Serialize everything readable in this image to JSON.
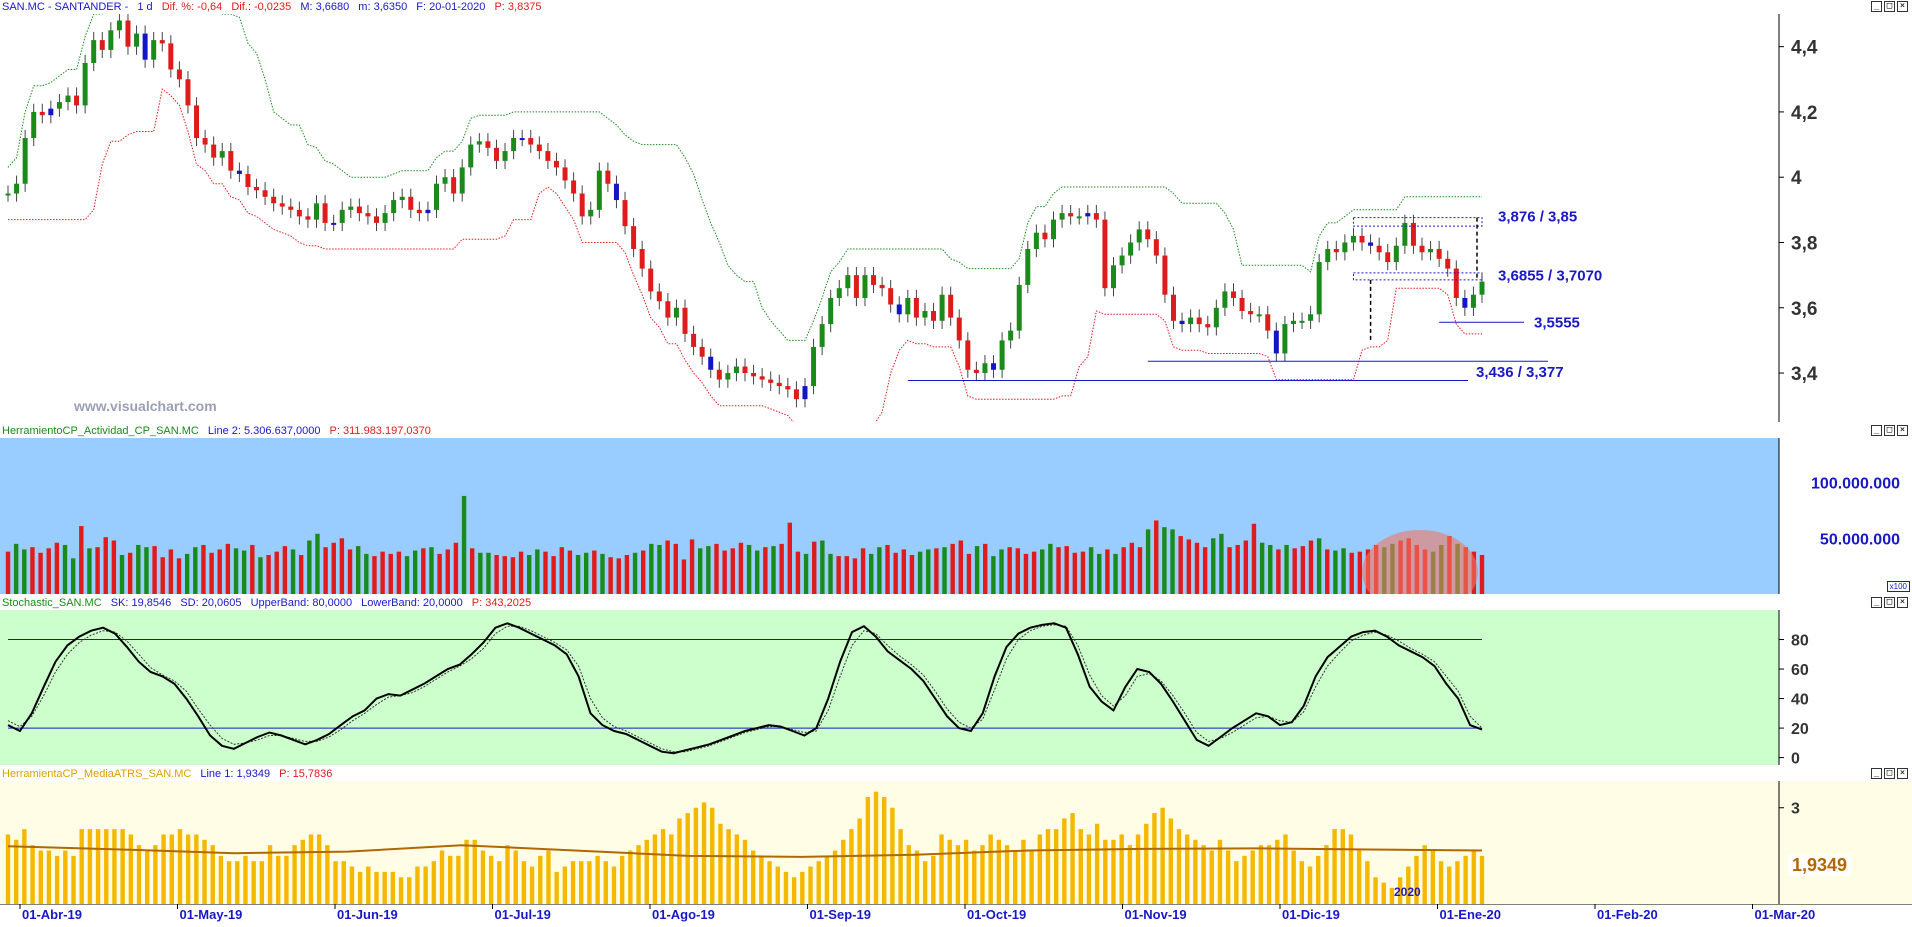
{
  "price_panel": {
    "header": {
      "symbol": "SAN.MC - SANTANDER -",
      "period": "1 d",
      "dif_pct": "Dif. %: -0,64",
      "dif": "Dif.: -0,0235",
      "max": "M: 3,6680",
      "min": "m: 3,6350",
      "date": "F: 20-01-2020",
      "price": "P: 3,8375"
    },
    "watermark": "www.visualchart.com",
    "annotations": [
      "3,876 / 3,85",
      "3,6855 / 3,7070",
      "3,5555",
      "3,436 / 3,377"
    ]
  },
  "volume_panel": {
    "header": {
      "name": "HerramientoCP_Actividad_CP_SAN.MC",
      "line": "Line 2: 5.306.637,0000",
      "price": "P: 311.983.197,0370"
    },
    "badge": "x100"
  },
  "stoch_panel": {
    "header": {
      "name": "Stochastic_SAN.MC",
      "sk": "SK: 19,8546",
      "sd": "SD: 20,0605",
      "upper": "UpperBand: 80,0000",
      "lower": "LowerBand: 20,0000",
      "price": "P: 343,2025"
    }
  },
  "atr_panel": {
    "header": {
      "name": "HerramientaCP_MediaATRS_SAN.MC",
      "line": "Line 1: 1,9349",
      "price": "P: 15,7836"
    },
    "value_label": "1,9349",
    "year_label": "2020"
  },
  "x_axis_labels": [
    "01-Abr-19",
    "01-May-19",
    "01-Jun-19",
    "01-Jul-19",
    "01-Ago-19",
    "01-Sep-19",
    "01-Oct-19",
    "01-Nov-19",
    "01-Dic-19",
    "01-Ene-20",
    "01-Feb-20",
    "01-Mar-20"
  ],
  "colors": {
    "up": "#1a8a1a",
    "down": "#e01b1b",
    "blue_candle": "#1515c8",
    "annotation": "#1818c8",
    "volume_bg": "#99ccff",
    "stoch_bg": "#ccffcc",
    "atr_bg": "#fffde6",
    "atr_bar": "#f5b800",
    "atr_line": "#b06800"
  },
  "chart_data": [
    {
      "type": "candlestick",
      "title": "SAN.MC - SANTANDER",
      "ylim": [
        3.25,
        4.5
      ],
      "yticks": [
        "4,4",
        "4,2",
        "4",
        "3,8",
        "3,6",
        "3,4"
      ],
      "ytick_values": [
        4.4,
        4.2,
        4.0,
        3.8,
        3.6,
        3.4
      ],
      "series": [
        {
          "name": "SANTANDER",
          "values": [
            3.95,
            3.98,
            4.12,
            4.2,
            4.19,
            4.21,
            4.23,
            4.25,
            4.22,
            4.35,
            4.42,
            4.39,
            4.45,
            4.48,
            4.4,
            4.44,
            4.36,
            4.42,
            4.41,
            4.33,
            4.3,
            4.22,
            4.12,
            4.1,
            4.06,
            4.08,
            4.02,
            4.01,
            3.97,
            3.96,
            3.94,
            3.92,
            3.91,
            3.9,
            3.88,
            3.87,
            3.92,
            3.86,
            3.86,
            3.9,
            3.91,
            3.89,
            3.88,
            3.86,
            3.89,
            3.93,
            3.94,
            3.9,
            3.89,
            3.9,
            3.98,
            4.0,
            3.95,
            4.03,
            4.1,
            4.11,
            4.09,
            4.05,
            4.08,
            4.12,
            4.12,
            4.1,
            4.08,
            4.05,
            4.03,
            3.99,
            3.95,
            3.88,
            3.9,
            4.02,
            3.98,
            3.93,
            3.85,
            3.78,
            3.72,
            3.65,
            3.62,
            3.57,
            3.6,
            3.52,
            3.48,
            3.45,
            3.41,
            3.38,
            3.4,
            3.42,
            3.4,
            3.39,
            3.38,
            3.37,
            3.36,
            3.35,
            3.32,
            3.36,
            3.48,
            3.55,
            3.63,
            3.66,
            3.7,
            3.63,
            3.7,
            3.67,
            3.66,
            3.61,
            3.58,
            3.63,
            3.57,
            3.59,
            3.56,
            3.64,
            3.57,
            3.5,
            3.41,
            3.4,
            3.43,
            3.41,
            3.5,
            3.53,
            3.67,
            3.78,
            3.83,
            3.81,
            3.87,
            3.89,
            3.88,
            3.88,
            3.89,
            3.87,
            3.66,
            3.73,
            3.76,
            3.8,
            3.84,
            3.81,
            3.76,
            3.64,
            3.56,
            3.55,
            3.57,
            3.55,
            3.54,
            3.6,
            3.65,
            3.63,
            3.59,
            3.58,
            3.58,
            3.53,
            3.46,
            3.55,
            3.56,
            3.56,
            3.58,
            3.74,
            3.78,
            3.77,
            3.8,
            3.82,
            3.8,
            3.79,
            3.77,
            3.74,
            3.79,
            3.86,
            3.79,
            3.77,
            3.78,
            3.75,
            3.72,
            3.63,
            3.6,
            3.64,
            3.68
          ]
        }
      ]
    },
    {
      "type": "bar",
      "title": "HerramientoCP_Actividad_CP_SAN.MC",
      "ylim": [
        0,
        140000000
      ],
      "yticks": [
        "100.000.000",
        "50.000.000"
      ],
      "ytick_values": [
        100000000,
        50000000
      ],
      "series": [
        {
          "name": "Actividad",
          "values": [
            38,
            45,
            40,
            42,
            37,
            41,
            46,
            44,
            32,
            61,
            41,
            42,
            51,
            48,
            35,
            37,
            44,
            42,
            43,
            33,
            40,
            32,
            36,
            42,
            44,
            37,
            40,
            45,
            41,
            39,
            44,
            33,
            35,
            38,
            43,
            40,
            35,
            48,
            54,
            42,
            46,
            50,
            40,
            43,
            36,
            34,
            38,
            36,
            38,
            34,
            39,
            41,
            42,
            36,
            40,
            46,
            88,
            41,
            37,
            37,
            35,
            34,
            33,
            38,
            35,
            40,
            38,
            34,
            42,
            39,
            35,
            37,
            39,
            36,
            33,
            32,
            35,
            37,
            39,
            45,
            44,
            48,
            45,
            31,
            49,
            41,
            43,
            45,
            39,
            41,
            46,
            44,
            39,
            42,
            43,
            45,
            64,
            38,
            36,
            47,
            48,
            36,
            34,
            34,
            32,
            41,
            36,
            42,
            44,
            37,
            40,
            35,
            38,
            40,
            41,
            42,
            45,
            48,
            36,
            43,
            45,
            34,
            40,
            42,
            41,
            36,
            38,
            40,
            45,
            42,
            43,
            37,
            38,
            42,
            36,
            40,
            36,
            42,
            46,
            42,
            58,
            66,
            60,
            58,
            52,
            49,
            46,
            42,
            50,
            54,
            42,
            44,
            48,
            63,
            46,
            44,
            40,
            44,
            41,
            43,
            48,
            50,
            40,
            39,
            41,
            37,
            38,
            40,
            44,
            42,
            45,
            48,
            50,
            44,
            40,
            38,
            44,
            52,
            45,
            42,
            38,
            35
          ]
        }
      ]
    },
    {
      "type": "line",
      "title": "Stochastic_SAN.MC",
      "ylim": [
        -5,
        100
      ],
      "yticks": [
        "80",
        "60",
        "40",
        "20",
        "0"
      ],
      "ytick_values": [
        80,
        60,
        40,
        20,
        0
      ],
      "upper_band": 80,
      "lower_band": 20,
      "series": [
        {
          "name": "SK",
          "values": [
            22,
            18,
            30,
            48,
            65,
            76,
            82,
            86,
            88,
            84,
            75,
            65,
            58,
            55,
            50,
            40,
            28,
            15,
            8,
            6,
            10,
            14,
            17,
            15,
            12,
            9,
            12,
            16,
            22,
            28,
            32,
            40,
            43,
            42,
            46,
            50,
            55,
            60,
            63,
            70,
            78,
            88,
            91,
            88,
            84,
            80,
            76,
            70,
            55,
            30,
            22,
            18,
            16,
            12,
            8,
            4,
            3,
            5,
            7,
            9,
            12,
            15,
            18,
            20,
            22,
            21,
            18,
            15,
            20,
            40,
            65,
            85,
            89,
            82,
            72,
            66,
            60,
            52,
            40,
            28,
            20,
            18,
            30,
            55,
            75,
            84,
            88,
            90,
            91,
            88,
            70,
            48,
            38,
            32,
            48,
            60,
            58,
            50,
            38,
            25,
            12,
            8,
            14,
            20,
            25,
            30,
            28,
            22,
            24,
            35,
            55,
            68,
            75,
            82,
            85,
            86,
            82,
            76,
            72,
            68,
            62,
            50,
            40,
            22,
            19
          ]
        },
        {
          "name": "SD",
          "values": [
            25,
            21,
            28,
            42,
            58,
            70,
            78,
            83,
            86,
            85,
            79,
            70,
            61,
            56,
            52,
            45,
            33,
            22,
            13,
            9,
            10,
            12,
            15,
            15,
            13,
            11,
            11,
            14,
            19,
            25,
            30,
            36,
            41,
            42,
            44,
            48,
            53,
            58,
            62,
            67,
            74,
            84,
            89,
            89,
            86,
            82,
            78,
            73,
            62,
            40,
            27,
            21,
            18,
            14,
            10,
            6,
            4,
            4,
            6,
            8,
            11,
            14,
            17,
            19,
            21,
            21,
            19,
            17,
            18,
            32,
            55,
            76,
            86,
            84,
            76,
            69,
            63,
            56,
            45,
            33,
            24,
            20,
            26,
            46,
            67,
            80,
            86,
            89,
            90,
            89,
            76,
            56,
            42,
            35,
            42,
            55,
            57,
            52,
            42,
            30,
            17,
            11,
            13,
            17,
            22,
            27,
            28,
            25,
            24,
            31,
            48,
            62,
            71,
            79,
            83,
            85,
            83,
            79,
            74,
            70,
            65,
            55,
            45,
            28,
            20
          ]
        }
      ]
    },
    {
      "type": "bar",
      "title": "HerramientaCP_MediaATRS_SAN.MC",
      "ylim": [
        1.2,
        3.5
      ],
      "yticks": [
        "3"
      ],
      "ytick_values": [
        3
      ],
      "series": [
        {
          "name": "ATR",
          "values": [
            2.5,
            2.4,
            2.6,
            2.3,
            2.2,
            2.2,
            2.1,
            2.2,
            2.1,
            2.6,
            2.6,
            2.6,
            2.6,
            2.6,
            2.6,
            2.5,
            2.3,
            2.2,
            2.3,
            2.5,
            2.5,
            2.6,
            2.5,
            2.5,
            2.4,
            2.3,
            2.1,
            2.0,
            2.0,
            2.1,
            2.0,
            2.0,
            2.3,
            2.1,
            2.1,
            2.3,
            2.4,
            2.5,
            2.5,
            2.3,
            2.0,
            2.0,
            1.9,
            1.8,
            1.9,
            1.8,
            1.8,
            1.8,
            1.7,
            1.7,
            1.9,
            1.9,
            2.0,
            2.2,
            2.1,
            2.1,
            2.4,
            2.4,
            2.2,
            2.1,
            2.0,
            2.3,
            2.2,
            2.0,
            1.9,
            2.1,
            2.2,
            1.8,
            1.9,
            2.0,
            2.0,
            2.0,
            2.1,
            2.0,
            1.9,
            2.1,
            2.2,
            2.3,
            2.4,
            2.5,
            2.6,
            2.5,
            2.8,
            2.9,
            3.0,
            3.1,
            3.0,
            2.7,
            2.6,
            2.5,
            2.4,
            2.2,
            2.1,
            2.0,
            1.9,
            1.8,
            1.7,
            1.8,
            1.9,
            2.0,
            2.1,
            2.2,
            2.4,
            2.6,
            2.8,
            3.2,
            3.3,
            3.2,
            3.0,
            2.6,
            2.3,
            2.2,
            2.0,
            2.1,
            2.5,
            2.4,
            2.3,
            2.4,
            2.2,
            2.3,
            2.5,
            2.4,
            2.3,
            2.2,
            2.4,
            2.2,
            2.5,
            2.6,
            2.6,
            2.8,
            2.9,
            2.6,
            2.5,
            2.7,
            2.4,
            2.4,
            2.5,
            2.3,
            2.5,
            2.7,
            2.9,
            3.0,
            2.8,
            2.6,
            2.5,
            2.4,
            2.3,
            2.2,
            2.4,
            2.2,
            2.0,
            2.1,
            2.2,
            2.3,
            2.3,
            2.4,
            2.5,
            2.2,
            2.0,
            1.9,
            2.1,
            2.3,
            2.6,
            2.6,
            2.5,
            2.2,
            2.0,
            1.7,
            1.6,
            1.5,
            1.7,
            1.9,
            2.1,
            2.3,
            2.2,
            2.0,
            1.9,
            2.0,
            2.1,
            2.2,
            2.1
          ]
        },
        {
          "name": "MediaATR",
          "values": [
            2.28,
            2.22,
            2.15,
            2.18,
            2.3,
            2.2,
            2.1,
            2.08,
            2.12,
            2.2,
            2.23,
            2.24,
            2.22,
            2.2
          ]
        }
      ]
    }
  ]
}
